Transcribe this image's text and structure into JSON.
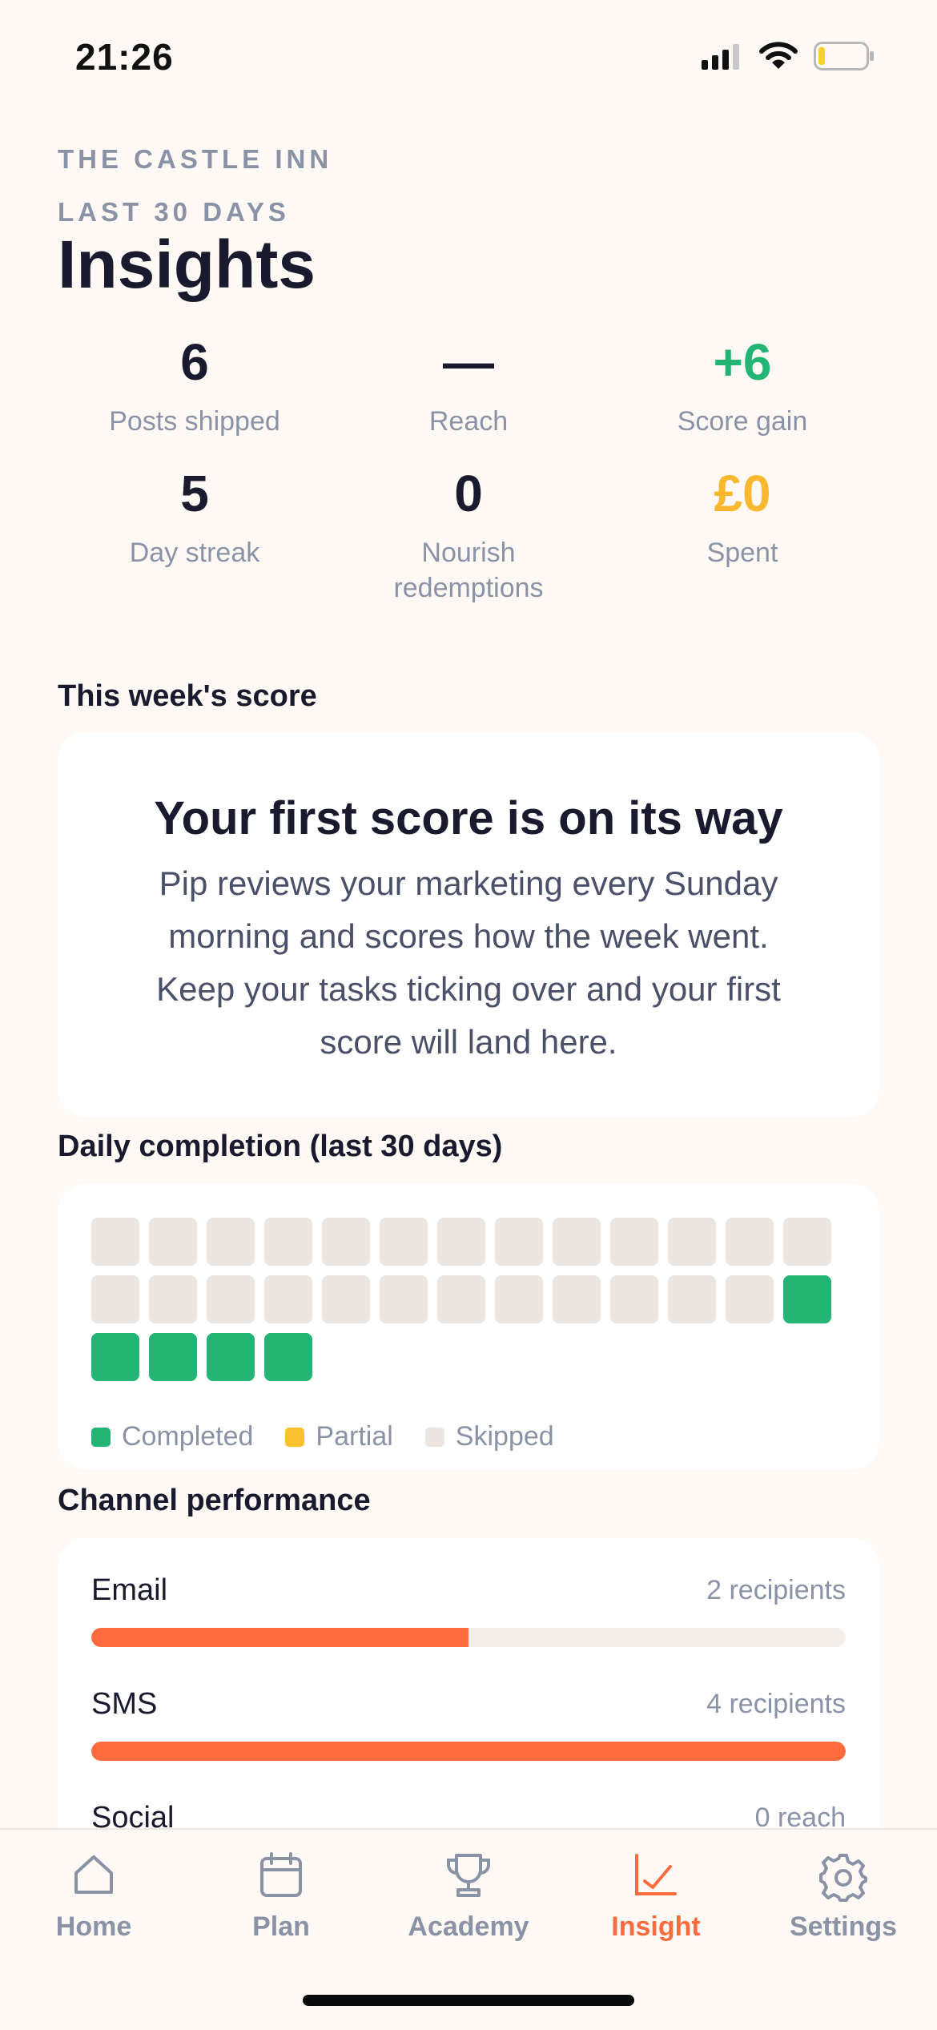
{
  "status_bar": {
    "time": "21:26"
  },
  "header": {
    "venue": "THE CASTLE INN",
    "period": "LAST 30 DAYS",
    "title": "Insights"
  },
  "stats": [
    {
      "value": "6",
      "label": "Posts shipped",
      "color": "#1A1A2E"
    },
    {
      "value": "—",
      "label": "Reach",
      "color": "#1A1A2E"
    },
    {
      "value": "+6",
      "label": "Score gain",
      "color": "#22B573"
    },
    {
      "value": "5",
      "label": "Day streak",
      "color": "#1A1A2E"
    },
    {
      "value": "0",
      "label": "Nourish redemptions",
      "color": "#1A1A2E"
    },
    {
      "value": "£0",
      "label": "Spent",
      "color": "#FBB82E"
    }
  ],
  "score_section": {
    "heading": "This week's score",
    "card_title": "Your first score is on its way",
    "card_text": "Pip reviews your marketing every Sunday morning and scores how the week went. Keep your tasks ticking over and your first score will land here."
  },
  "completion_section": {
    "heading": "Daily completion (last 30 days)",
    "days": [
      "skipped",
      "skipped",
      "skipped",
      "skipped",
      "skipped",
      "skipped",
      "skipped",
      "skipped",
      "skipped",
      "skipped",
      "skipped",
      "skipped",
      "skipped",
      "skipped",
      "skipped",
      "skipped",
      "skipped",
      "skipped",
      "skipped",
      "skipped",
      "skipped",
      "skipped",
      "skipped",
      "skipped",
      "skipped",
      "completed",
      "completed",
      "completed",
      "completed",
      "completed"
    ],
    "legend": [
      {
        "label": "Completed",
        "color": "#22B573"
      },
      {
        "label": "Partial",
        "color": "#FBC02D"
      },
      {
        "label": "Skipped",
        "color": "#EDE5DF"
      }
    ]
  },
  "channel_section": {
    "heading": "Channel performance",
    "channels": [
      {
        "name": "Email",
        "meta": "2 recipients",
        "fill_pct": 50
      },
      {
        "name": "SMS",
        "meta": "4 recipients",
        "fill_pct": 100
      },
      {
        "name": "Social",
        "meta": "0 reach",
        "fill_pct": 0
      }
    ]
  },
  "tabs": [
    {
      "label": "Home",
      "icon": "home-icon",
      "active": false
    },
    {
      "label": "Plan",
      "icon": "calendar-icon",
      "active": false
    },
    {
      "label": "Academy",
      "icon": "trophy-icon",
      "active": false
    },
    {
      "label": "Insight",
      "icon": "chart-icon",
      "active": true
    },
    {
      "label": "Settings",
      "icon": "gear-icon",
      "active": false
    }
  ],
  "colors": {
    "accent": "#FF6B3D",
    "completed": "#22B573",
    "partial": "#FBC02D",
    "skipped": "#EDE5DF"
  }
}
